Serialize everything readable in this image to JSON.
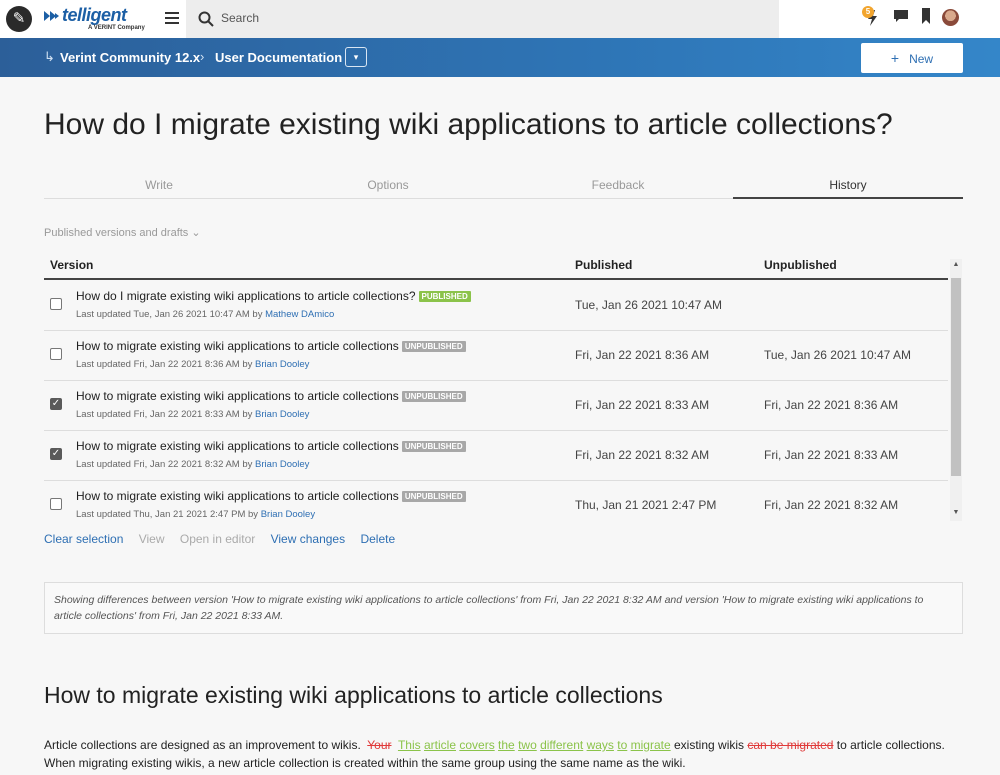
{
  "topbar": {
    "logo_text": "telligent",
    "logo_sub": "A VERINT Company",
    "search_placeholder": "Search",
    "notification_count": "5"
  },
  "breadcrumb": {
    "items": [
      "Verint Community 12.x",
      "User Documentation"
    ],
    "new_button": "New"
  },
  "page_title": "How do I migrate existing wiki applications to article collections?",
  "tabs": [
    {
      "label": "Write",
      "active": false
    },
    {
      "label": "Options",
      "active": false
    },
    {
      "label": "Feedback",
      "active": false
    },
    {
      "label": "History",
      "active": true
    }
  ],
  "filter_label": "Published versions and drafts",
  "table": {
    "headers": {
      "version": "Version",
      "published": "Published",
      "unpublished": "Unpublished"
    },
    "rows": [
      {
        "title": "How do I migrate existing wiki applications to article collections?",
        "status": "PUBLISHED",
        "updated": "Last updated Tue, Jan 26 2021 10:47 AM by",
        "author": "Mathew DAmico",
        "published": "Tue, Jan 26 2021 10:47 AM",
        "unpublished": "",
        "checked": false
      },
      {
        "title": "How to migrate existing wiki applications to article collections",
        "status": "UNPUBLISHED",
        "updated": "Last updated Fri, Jan 22 2021 8:36 AM by",
        "author": "Brian Dooley",
        "published": "Fri, Jan 22 2021 8:36 AM",
        "unpublished": "Tue, Jan 26 2021 10:47 AM",
        "checked": false
      },
      {
        "title": "How to migrate existing wiki applications to article collections",
        "status": "UNPUBLISHED",
        "updated": "Last updated Fri, Jan 22 2021 8:33 AM by",
        "author": "Brian Dooley",
        "published": "Fri, Jan 22 2021 8:33 AM",
        "unpublished": "Fri, Jan 22 2021 8:36 AM",
        "checked": true
      },
      {
        "title": "How to migrate existing wiki applications to article collections",
        "status": "UNPUBLISHED",
        "updated": "Last updated Fri, Jan 22 2021 8:32 AM by",
        "author": "Brian Dooley",
        "published": "Fri, Jan 22 2021 8:32 AM",
        "unpublished": "Fri, Jan 22 2021 8:33 AM",
        "checked": true
      },
      {
        "title": "How to migrate existing wiki applications to article collections",
        "status": "UNPUBLISHED",
        "updated": "Last updated Thu, Jan 21 2021 2:47 PM by",
        "author": "Brian Dooley",
        "published": "Thu, Jan 21 2021 2:47 PM",
        "unpublished": "Fri, Jan 22 2021 8:32 AM",
        "checked": false
      }
    ]
  },
  "actions": {
    "clear_selection": "Clear selection",
    "view": "View",
    "open_in_editor": "Open in editor",
    "view_changes": "View changes",
    "delete": "Delete"
  },
  "diff_note": "Showing differences between version 'How to migrate existing wiki applications to article collections' from Fri, Jan 22 2021 8:32 AM and version 'How to migrate existing wiki applications to article collections' from Fri, Jan 22 2021 8:33 AM.",
  "article": {
    "heading": "How to migrate existing wiki applications to article collections",
    "p_start": "Article collections are designed as an improvement to wikis.",
    "del_1": "Your",
    "ins_words": [
      "This",
      "article",
      "covers",
      "the",
      "two",
      "different",
      "ways",
      "to",
      "migrate"
    ],
    "mid": "existing wikis",
    "del_2": "can be migrated",
    "p_end": "to article collections.  When migrating existing wikis, a new article collection is created within the same group using the same name as the wiki."
  },
  "colors": {
    "accent": "#2e6fb3",
    "published": "#8bc34a",
    "unpublished": "#a8a8a8",
    "deleted": "#e03a3a",
    "inserted": "#8bc34a"
  }
}
